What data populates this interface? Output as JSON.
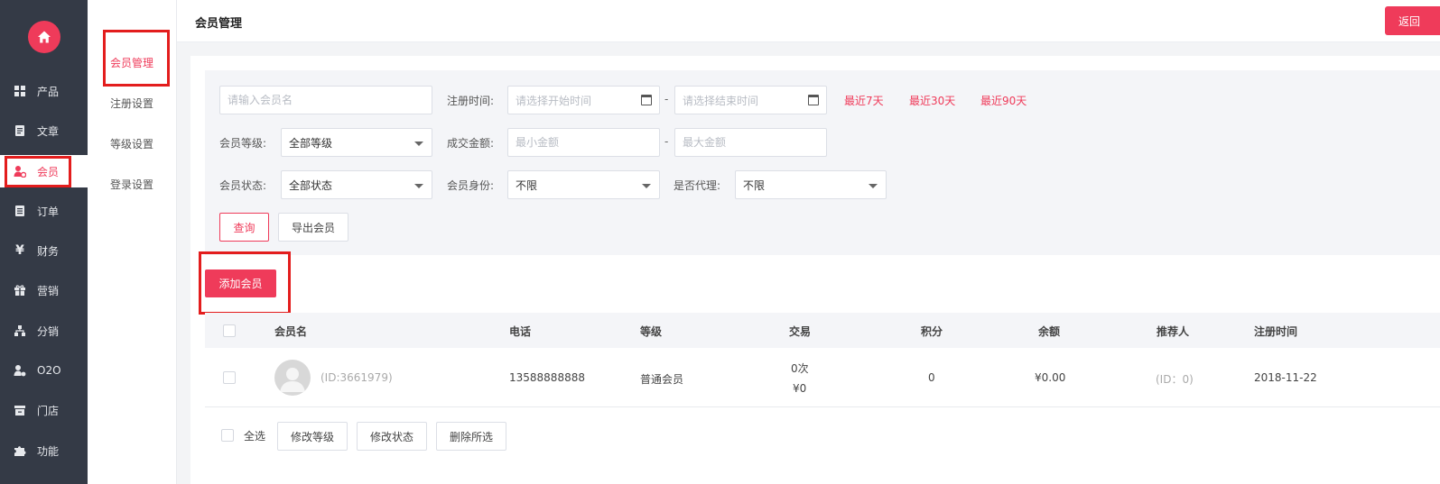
{
  "sidebar": {
    "logo_icon": "home-icon",
    "items": [
      {
        "label": "产品",
        "icon": "grid-icon"
      },
      {
        "label": "文章",
        "icon": "document-icon"
      },
      {
        "label": "会员",
        "icon": "member-icon"
      },
      {
        "label": "订单",
        "icon": "order-icon"
      },
      {
        "label": "财务",
        "icon": "yen-icon"
      },
      {
        "label": "营销",
        "icon": "gift-icon"
      },
      {
        "label": "分销",
        "icon": "distribution-icon"
      },
      {
        "label": "O2O",
        "icon": "o2o-icon"
      },
      {
        "label": "门店",
        "icon": "store-icon"
      },
      {
        "label": "功能",
        "icon": "puzzle-icon"
      }
    ],
    "active_index": 2
  },
  "subnav": {
    "items": [
      "会员管理",
      "注册设置",
      "等级设置",
      "登录设置"
    ],
    "active_index": 0
  },
  "header": {
    "title": "会员管理",
    "back_label": "返回"
  },
  "filters": {
    "member_name_placeholder": "请输入会员名",
    "reg_time_label": "注册时间:",
    "start_placeholder": "请选择开始时间",
    "end_placeholder": "请选择结束时间",
    "range_sep": "-",
    "quick_ranges": [
      "最近7天",
      "最近30天",
      "最近90天"
    ],
    "level_label": "会员等级:",
    "level_value": "全部等级",
    "amount_label": "成交金额:",
    "min_placeholder": "最小金额",
    "max_placeholder": "最大金额",
    "status_label": "会员状态:",
    "status_value": "全部状态",
    "identity_label": "会员身份:",
    "identity_value": "不限",
    "agent_label": "是否代理:",
    "agent_value": "不限",
    "query_label": "查询",
    "export_label": "导出会员"
  },
  "add_member_label": "添加会员",
  "table": {
    "columns": [
      "会员名",
      "电话",
      "等级",
      "交易",
      "积分",
      "余额",
      "推荐人",
      "注册时间"
    ],
    "rows": [
      {
        "name": "(ID:3661979)",
        "phone": "13588888888",
        "level": "普通会员",
        "trade_count": "0次",
        "trade_amount": "¥0",
        "points": "0",
        "balance": "¥0.00",
        "referrer": "(ID：0)",
        "reg_date": "2018-11-22"
      }
    ]
  },
  "footer": {
    "select_all_label": "全选",
    "actions": [
      "修改等级",
      "修改状态",
      "删除所选"
    ]
  },
  "colors": {
    "accent": "#ef3b5a",
    "sidebar_bg": "#343a46",
    "highlight_box": "#e31d1d"
  }
}
